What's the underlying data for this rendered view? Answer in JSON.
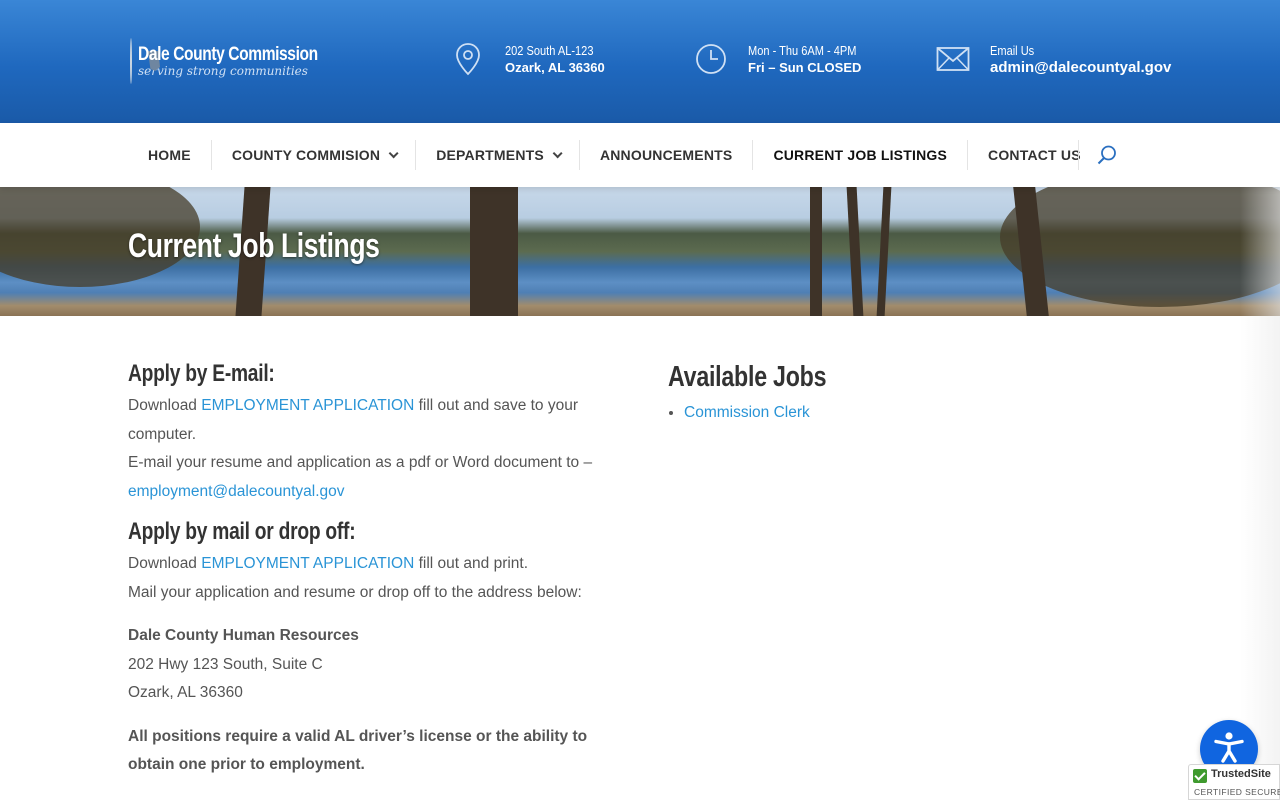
{
  "header": {
    "logo": {
      "title": "Dale County Commission",
      "tagline": "serving strong communities",
      "seal_text": "DALE COUNTY COMMISSION"
    },
    "address": {
      "icon": "map-pin-icon",
      "line1": "202 South AL-123",
      "line2": "Ozark, AL 36360"
    },
    "hours": {
      "icon": "clock-icon",
      "line1": "Mon - Thu 6AM - 4PM",
      "line2": "Fri – Sun CLOSED"
    },
    "email": {
      "icon": "envelope-icon",
      "line1": "Email Us",
      "line2": "admin@dalecountyal.gov"
    },
    "colors": {
      "header_bg": "#1f68be",
      "link": "#2a94d6",
      "accessibility_button": "#1065e0"
    }
  },
  "nav": {
    "items": [
      {
        "label": "HOME",
        "dropdown": false
      },
      {
        "label": "COUNTY COMMISION",
        "dropdown": true
      },
      {
        "label": "DEPARTMENTS",
        "dropdown": true
      },
      {
        "label": "ANNOUNCEMENTS",
        "dropdown": false
      },
      {
        "label": "CURRENT JOB LISTINGS",
        "dropdown": false,
        "active": true
      },
      {
        "label": "CONTACT US",
        "dropdown": false
      }
    ],
    "search_icon": "search-icon"
  },
  "hero": {
    "title": "Current Job Listings"
  },
  "content": {
    "email_section": {
      "heading": "Apply by E-mail:",
      "download_prefix": "Download ",
      "download_link": "EMPLOYMENT APPLICATION",
      "download_suffix": " fill out and save to your computer.",
      "email_instruction": "E-mail your resume and application as a pdf or Word document to –",
      "email_link": "employment@dalecountyal.gov"
    },
    "mail_section": {
      "heading": "Apply by mail or drop off:",
      "download_prefix": "Download ",
      "download_link": "EMPLOYMENT APPLICATION",
      "download_suffix": " fill out and print.",
      "mail_instruction": "Mail your application and resume or drop off to the address below:"
    },
    "address_block": {
      "name": "Dale County Human Resources",
      "line1": "202 Hwy 123 South, Suite C",
      "line2": "Ozark, AL 36360"
    },
    "requirement": "All positions require a valid AL driver’s license or the ability to obtain one prior to employment.",
    "jobs": {
      "heading": "Available Jobs",
      "items": [
        "Commission Clerk"
      ]
    }
  },
  "widgets": {
    "accessibility_icon": "accessibility-icon",
    "trusted_site": {
      "title": "TrustedSite",
      "subtitle": "CERTIFIED SECURE"
    }
  }
}
